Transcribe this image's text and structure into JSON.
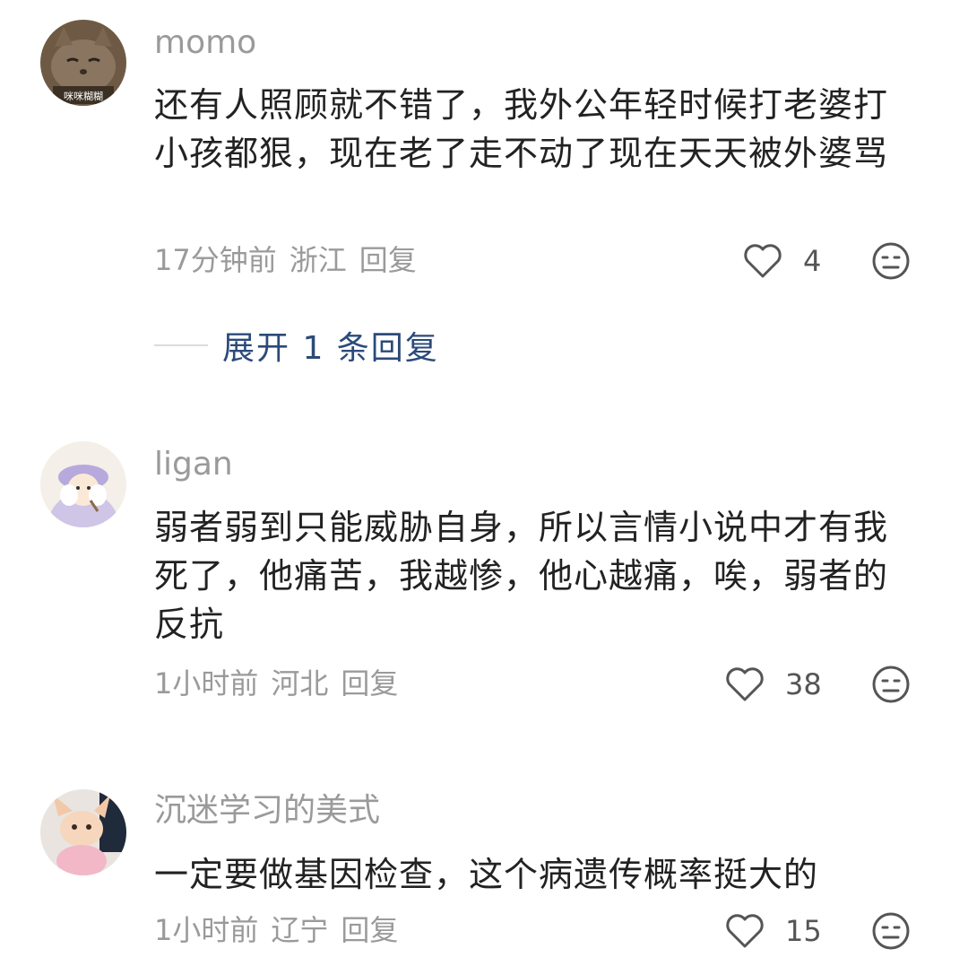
{
  "comments": [
    {
      "username": "momo",
      "avatar_caption": "咪咪糊糊",
      "text": "还有人照顾就不错了，我外公年轻时候打老婆打小孩都狠，现在老了走不动了现在天天被外婆骂",
      "time": "17分钟前",
      "location": "浙江",
      "reply_label": "回复",
      "likes": "4"
    },
    {
      "username": "ligan",
      "text": "弱者弱到只能威胁自身，所以言情小说中才有我死了，他痛苦，我越惨，他心越痛，唉，弱者的反抗",
      "time": "1小时前",
      "location": "河北",
      "reply_label": "回复",
      "likes": "38"
    },
    {
      "username": "沉迷学习的美式",
      "text": "一定要做基因检查，这个病遗传概率挺大的",
      "time": "1小时前",
      "location": "辽宁",
      "reply_label": "回复",
      "likes": "15"
    }
  ],
  "expand_replies": {
    "label": "展开 1 条回复"
  },
  "icons": {
    "like": "heart-outline-icon",
    "dislike": "meh-face-icon"
  },
  "colors": {
    "text": "#222222",
    "meta": "#9a9a9a",
    "expand_link": "#2b4a79"
  }
}
